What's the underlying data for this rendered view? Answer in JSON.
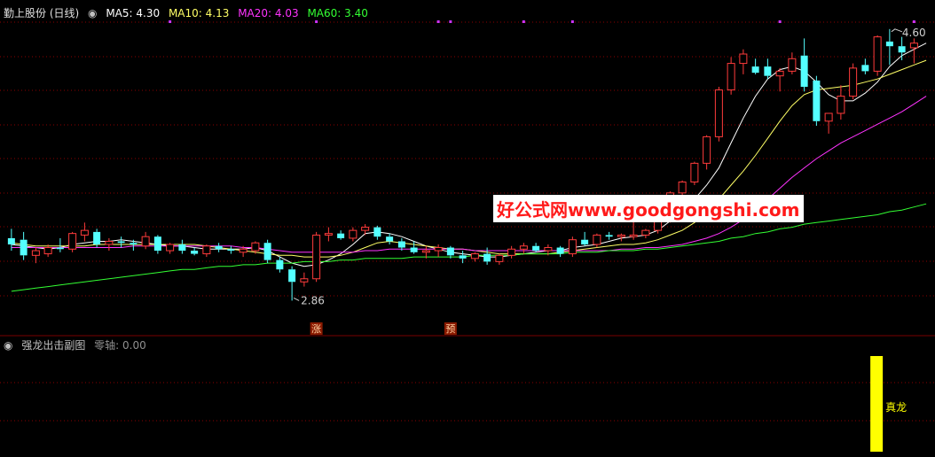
{
  "main_header": {
    "title": "勤上股份 (日线)",
    "ma5_label": "MA5: 4.30",
    "ma10_label": "MA10: 4.13",
    "ma20_label": "MA20: 4.03",
    "ma60_label": "MA60: 3.40"
  },
  "sub_header": {
    "title": "强龙出击副图",
    "zero_axis": "零轴: 0.00"
  },
  "watermark": "好公式网www.goodgongshi.com",
  "annotations": {
    "high_label": "4.60",
    "low_label": "2.86",
    "marker_zhang": "涨",
    "marker_yu": "预",
    "signal_label": "真龙"
  },
  "colors": {
    "background": "#000000",
    "grid": "#8b0000",
    "up_candle": "#ff3b3b",
    "down_candle": "#54ffff",
    "ma5": "#ffffff",
    "ma10": "#ffff66",
    "ma20": "#ff33ff",
    "ma60": "#33ff33",
    "signal_bar": "#ffff00",
    "dots": "#cc33ff"
  },
  "chart_data": [
    {
      "type": "candlestick",
      "ylim": [
        2.8,
        4.65
      ],
      "candles": [
        {
          "o": 3.26,
          "h": 3.32,
          "l": 3.18,
          "c": 3.22
        },
        {
          "o": 3.25,
          "h": 3.3,
          "l": 3.12,
          "c": 3.15
        },
        {
          "o": 3.15,
          "h": 3.2,
          "l": 3.1,
          "c": 3.18
        },
        {
          "o": 3.16,
          "h": 3.22,
          "l": 3.14,
          "c": 3.2
        },
        {
          "o": 3.2,
          "h": 3.26,
          "l": 3.17,
          "c": 3.19
        },
        {
          "o": 3.19,
          "h": 3.3,
          "l": 3.17,
          "c": 3.29
        },
        {
          "o": 3.28,
          "h": 3.36,
          "l": 3.24,
          "c": 3.31
        },
        {
          "o": 3.3,
          "h": 3.32,
          "l": 3.2,
          "c": 3.22
        },
        {
          "o": 3.22,
          "h": 3.26,
          "l": 3.18,
          "c": 3.24
        },
        {
          "o": 3.24,
          "h": 3.27,
          "l": 3.2,
          "c": 3.23
        },
        {
          "o": 3.23,
          "h": 3.25,
          "l": 3.18,
          "c": 3.22
        },
        {
          "o": 3.21,
          "h": 3.3,
          "l": 3.19,
          "c": 3.27
        },
        {
          "o": 3.27,
          "h": 3.28,
          "l": 3.16,
          "c": 3.18
        },
        {
          "o": 3.18,
          "h": 3.23,
          "l": 3.16,
          "c": 3.22
        },
        {
          "o": 3.22,
          "h": 3.25,
          "l": 3.16,
          "c": 3.18
        },
        {
          "o": 3.18,
          "h": 3.2,
          "l": 3.15,
          "c": 3.16
        },
        {
          "o": 3.16,
          "h": 3.22,
          "l": 3.14,
          "c": 3.21
        },
        {
          "o": 3.21,
          "h": 3.23,
          "l": 3.17,
          "c": 3.19
        },
        {
          "o": 3.19,
          "h": 3.21,
          "l": 3.16,
          "c": 3.18
        },
        {
          "o": 3.17,
          "h": 3.21,
          "l": 3.14,
          "c": 3.19
        },
        {
          "o": 3.18,
          "h": 3.24,
          "l": 3.16,
          "c": 3.23
        },
        {
          "o": 3.23,
          "h": 3.25,
          "l": 3.1,
          "c": 3.12
        },
        {
          "o": 3.12,
          "h": 3.14,
          "l": 3.04,
          "c": 3.06
        },
        {
          "o": 3.06,
          "h": 3.08,
          "l": 2.86,
          "c": 2.98
        },
        {
          "o": 2.98,
          "h": 3.04,
          "l": 2.95,
          "c": 3.0
        },
        {
          "o": 3.0,
          "h": 3.3,
          "l": 2.98,
          "c": 3.28
        },
        {
          "o": 3.28,
          "h": 3.33,
          "l": 3.24,
          "c": 3.29
        },
        {
          "o": 3.29,
          "h": 3.31,
          "l": 3.25,
          "c": 3.26
        },
        {
          "o": 3.26,
          "h": 3.33,
          "l": 3.24,
          "c": 3.31
        },
        {
          "o": 3.31,
          "h": 3.35,
          "l": 3.28,
          "c": 3.33
        },
        {
          "o": 3.33,
          "h": 3.34,
          "l": 3.25,
          "c": 3.27
        },
        {
          "o": 3.27,
          "h": 3.29,
          "l": 3.22,
          "c": 3.24
        },
        {
          "o": 3.24,
          "h": 3.26,
          "l": 3.18,
          "c": 3.2
        },
        {
          "o": 3.2,
          "h": 3.24,
          "l": 3.16,
          "c": 3.17
        },
        {
          "o": 3.17,
          "h": 3.21,
          "l": 3.13,
          "c": 3.18
        },
        {
          "o": 3.18,
          "h": 3.22,
          "l": 3.14,
          "c": 3.2
        },
        {
          "o": 3.2,
          "h": 3.21,
          "l": 3.13,
          "c": 3.15
        },
        {
          "o": 3.15,
          "h": 3.18,
          "l": 3.1,
          "c": 3.13
        },
        {
          "o": 3.13,
          "h": 3.17,
          "l": 3.11,
          "c": 3.16
        },
        {
          "o": 3.16,
          "h": 3.2,
          "l": 3.09,
          "c": 3.11
        },
        {
          "o": 3.11,
          "h": 3.16,
          "l": 3.09,
          "c": 3.15
        },
        {
          "o": 3.15,
          "h": 3.21,
          "l": 3.13,
          "c": 3.19
        },
        {
          "o": 3.19,
          "h": 3.23,
          "l": 3.16,
          "c": 3.21
        },
        {
          "o": 3.21,
          "h": 3.23,
          "l": 3.17,
          "c": 3.18
        },
        {
          "o": 3.18,
          "h": 3.22,
          "l": 3.15,
          "c": 3.2
        },
        {
          "o": 3.2,
          "h": 3.21,
          "l": 3.14,
          "c": 3.16
        },
        {
          "o": 3.16,
          "h": 3.27,
          "l": 3.14,
          "c": 3.25
        },
        {
          "o": 3.25,
          "h": 3.3,
          "l": 3.21,
          "c": 3.22
        },
        {
          "o": 3.22,
          "h": 3.29,
          "l": 3.2,
          "c": 3.28
        },
        {
          "o": 3.28,
          "h": 3.3,
          "l": 3.25,
          "c": 3.27
        },
        {
          "o": 3.27,
          "h": 3.29,
          "l": 3.24,
          "c": 3.28
        },
        {
          "o": 3.27,
          "h": 3.46,
          "l": 3.25,
          "c": 3.28
        },
        {
          "o": 3.28,
          "h": 3.32,
          "l": 3.26,
          "c": 3.31
        },
        {
          "o": 3.31,
          "h": 3.4,
          "l": 3.29,
          "c": 3.38
        },
        {
          "o": 3.38,
          "h": 3.56,
          "l": 3.36,
          "c": 3.55
        },
        {
          "o": 3.55,
          "h": 3.63,
          "l": 3.52,
          "c": 3.62
        },
        {
          "o": 3.62,
          "h": 3.75,
          "l": 3.6,
          "c": 3.74
        },
        {
          "o": 3.74,
          "h": 3.92,
          "l": 3.7,
          "c": 3.91
        },
        {
          "o": 3.91,
          "h": 4.23,
          "l": 3.88,
          "c": 4.21
        },
        {
          "o": 4.21,
          "h": 4.42,
          "l": 4.18,
          "c": 4.38
        },
        {
          "o": 4.38,
          "h": 4.47,
          "l": 4.31,
          "c": 4.44
        },
        {
          "o": 4.36,
          "h": 4.41,
          "l": 4.31,
          "c": 4.32
        },
        {
          "o": 4.36,
          "h": 4.41,
          "l": 4.28,
          "c": 4.3
        },
        {
          "o": 4.3,
          "h": 4.35,
          "l": 4.2,
          "c": 4.33
        },
        {
          "o": 4.33,
          "h": 4.45,
          "l": 4.31,
          "c": 4.41
        },
        {
          "o": 4.43,
          "h": 4.54,
          "l": 4.2,
          "c": 4.23
        },
        {
          "o": 4.27,
          "h": 4.3,
          "l": 3.98,
          "c": 4.01
        },
        {
          "o": 4.01,
          "h": 4.06,
          "l": 3.93,
          "c": 4.06
        },
        {
          "o": 4.06,
          "h": 4.24,
          "l": 4.02,
          "c": 4.17
        },
        {
          "o": 4.17,
          "h": 4.38,
          "l": 4.15,
          "c": 4.35
        },
        {
          "o": 4.37,
          "h": 4.41,
          "l": 4.31,
          "c": 4.33
        },
        {
          "o": 4.33,
          "h": 4.56,
          "l": 4.3,
          "c": 4.55
        },
        {
          "o": 4.52,
          "h": 4.6,
          "l": 4.37,
          "c": 4.49
        },
        {
          "o": 4.49,
          "h": 4.55,
          "l": 4.4,
          "c": 4.45
        },
        {
          "o": 4.48,
          "h": 4.54,
          "l": 4.38,
          "c": 4.51
        }
      ],
      "ma": {
        "MA5": [
          3.22,
          3.21,
          3.2,
          3.19,
          3.2,
          3.22,
          3.23,
          3.24,
          3.24,
          3.25,
          3.24,
          3.23,
          3.22,
          3.21,
          3.21,
          3.2,
          3.19,
          3.19,
          3.19,
          3.19,
          3.2,
          3.18,
          3.14,
          3.1,
          3.08,
          3.09,
          3.12,
          3.16,
          3.22,
          3.29,
          3.3,
          3.29,
          3.27,
          3.24,
          3.21,
          3.19,
          3.17,
          3.16,
          3.15,
          3.14,
          3.14,
          3.15,
          3.16,
          3.17,
          3.18,
          3.18,
          3.2,
          3.21,
          3.22,
          3.24,
          3.26,
          3.27,
          3.28,
          3.31,
          3.37,
          3.43,
          3.51,
          3.6,
          3.71,
          3.87,
          4.03,
          4.17,
          4.28,
          4.34,
          4.36,
          4.33,
          4.26,
          4.18,
          4.14,
          4.14,
          4.19,
          4.26,
          4.36,
          4.43,
          4.47,
          4.51
        ],
        "MA10": [
          3.23,
          3.22,
          3.21,
          3.21,
          3.21,
          3.21,
          3.21,
          3.22,
          3.22,
          3.22,
          3.22,
          3.22,
          3.22,
          3.22,
          3.22,
          3.22,
          3.21,
          3.2,
          3.19,
          3.18,
          3.17,
          3.16,
          3.15,
          3.15,
          3.14,
          3.14,
          3.14,
          3.15,
          3.17,
          3.2,
          3.23,
          3.24,
          3.23,
          3.22,
          3.21,
          3.2,
          3.19,
          3.19,
          3.18,
          3.17,
          3.16,
          3.16,
          3.16,
          3.16,
          3.16,
          3.17,
          3.18,
          3.19,
          3.2,
          3.21,
          3.22,
          3.22,
          3.23,
          3.25,
          3.28,
          3.31,
          3.36,
          3.43,
          3.51,
          3.6,
          3.69,
          3.79,
          3.9,
          4.01,
          4.11,
          4.18,
          4.21,
          4.22,
          4.23,
          4.24,
          4.26,
          4.28,
          4.31,
          4.34,
          4.37,
          4.4
        ],
        "MA20": [
          3.2,
          3.2,
          3.2,
          3.2,
          3.2,
          3.2,
          3.2,
          3.2,
          3.2,
          3.2,
          3.21,
          3.21,
          3.21,
          3.21,
          3.21,
          3.21,
          3.21,
          3.21,
          3.21,
          3.2,
          3.2,
          3.19,
          3.18,
          3.17,
          3.17,
          3.17,
          3.17,
          3.17,
          3.17,
          3.18,
          3.18,
          3.19,
          3.19,
          3.19,
          3.19,
          3.19,
          3.19,
          3.19,
          3.18,
          3.18,
          3.18,
          3.18,
          3.18,
          3.18,
          3.18,
          3.18,
          3.18,
          3.18,
          3.18,
          3.18,
          3.19,
          3.19,
          3.2,
          3.2,
          3.21,
          3.22,
          3.24,
          3.26,
          3.29,
          3.33,
          3.38,
          3.44,
          3.51,
          3.58,
          3.65,
          3.71,
          3.77,
          3.82,
          3.87,
          3.91,
          3.95,
          3.99,
          4.03,
          4.07,
          4.12,
          4.17
        ],
        "MA60": [
          2.92,
          2.93,
          2.94,
          2.95,
          2.96,
          2.97,
          2.98,
          2.99,
          3.0,
          3.01,
          3.02,
          3.03,
          3.04,
          3.05,
          3.06,
          3.06,
          3.07,
          3.08,
          3.08,
          3.09,
          3.09,
          3.1,
          3.1,
          3.1,
          3.11,
          3.11,
          3.11,
          3.12,
          3.12,
          3.13,
          3.13,
          3.13,
          3.13,
          3.14,
          3.14,
          3.14,
          3.14,
          3.14,
          3.15,
          3.15,
          3.15,
          3.15,
          3.16,
          3.16,
          3.16,
          3.16,
          3.17,
          3.17,
          3.17,
          3.18,
          3.18,
          3.18,
          3.19,
          3.19,
          3.2,
          3.21,
          3.22,
          3.23,
          3.24,
          3.26,
          3.27,
          3.29,
          3.3,
          3.32,
          3.33,
          3.35,
          3.36,
          3.37,
          3.38,
          3.39,
          3.4,
          3.41,
          3.43,
          3.44,
          3.46,
          3.48
        ]
      },
      "extremes": {
        "high": {
          "index": 72,
          "value": 4.6
        },
        "low": {
          "index": 23,
          "value": 2.86
        }
      },
      "markers": [
        {
          "index": 25,
          "text": "涨"
        },
        {
          "index": 36,
          "text": "预"
        }
      ],
      "dots": [
        13,
        25,
        35,
        36,
        42,
        46,
        63,
        74
      ]
    },
    {
      "type": "bar",
      "title": "强龙出击副图",
      "zero_axis": 0.0,
      "signals": [
        {
          "index": 71,
          "label": "真龙"
        }
      ]
    }
  ]
}
